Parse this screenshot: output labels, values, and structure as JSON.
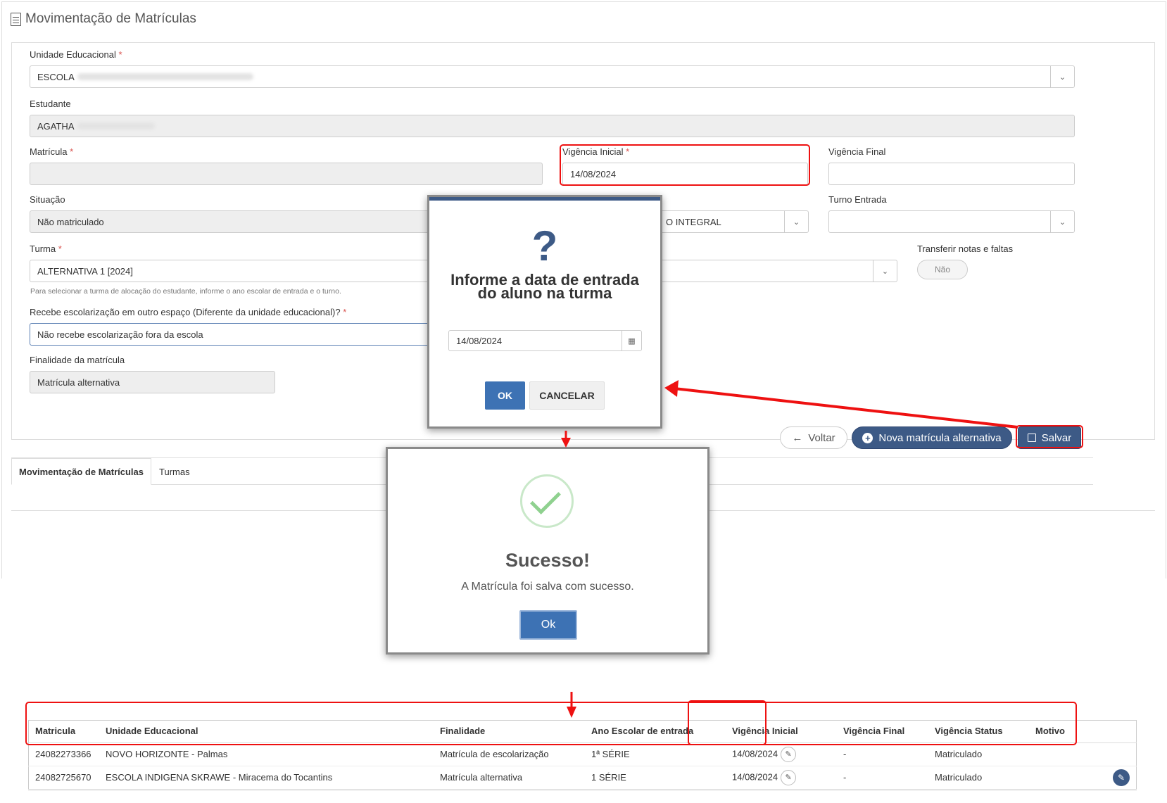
{
  "page": {
    "title": "Movimentação de Matrículas"
  },
  "form": {
    "unidade_label": "Unidade Educacional",
    "unidade_value": "ESCOLA",
    "estudante_label": "Estudante",
    "estudante_value": "AGATHA",
    "matricula_label": "Matrícula",
    "matricula_value": "",
    "vig_inicial_label": "Vigência Inicial",
    "vig_inicial_value": "14/08/2024",
    "vig_final_label": "Vigência Final",
    "vig_final_value": "",
    "situacao_label": "Situação",
    "situacao_value": "Não matriculado",
    "modalidade_value": "O INTEGRAL",
    "turno_label": "Turno Entrada",
    "turno_value": "",
    "turma_label": "Turma",
    "turma_value": "ALTERNATIVA 1 [2024]",
    "turma_hint": "Para selecionar a turma de alocação do estudante, informe o ano escolar de entrada e o turno.",
    "transferir_label": "Transferir notas e faltas",
    "transferir_value": "Não",
    "recebe_label": "Recebe escolarização em outro espaço (Diferente da unidade educacional)?",
    "recebe_value": "Não recebe escolarização fora da escola",
    "finalidade_label": "Finalidade da matrícula",
    "finalidade_value": "Matrícula alternativa",
    "required_mark": "*"
  },
  "actions": {
    "voltar": "Voltar",
    "nova": "Nova matrícula alternativa",
    "salvar": "Salvar"
  },
  "tabs": [
    "Movimentação de Matrículas",
    "Turmas"
  ],
  "dialog_date": {
    "icon": "?",
    "title": "Informe a data de entrada do aluno na turma",
    "date_value": "14/08/2024",
    "ok": "OK",
    "cancel": "CANCELAR"
  },
  "dialog_success": {
    "title": "Sucesso!",
    "message": "A Matrícula foi salva com sucesso.",
    "ok": "Ok"
  },
  "table": {
    "headers": [
      "Matricula",
      "Unidade Educacional",
      "Finalidade",
      "Ano Escolar de entrada",
      "Vigência Inicial",
      "Vigência Final",
      "Vigência Status",
      "Motivo"
    ],
    "rows": [
      [
        "24082273366",
        "NOVO HORIZONTE - Palmas",
        "Matrícula de escolarização",
        "1ª SÉRIE",
        "14/08/2024",
        "-",
        "Matriculado",
        ""
      ],
      [
        "24082725670",
        "ESCOLA INDIGENA SKRAWE - Miracema do Tocantins",
        "Matrícula alternativa",
        "1 SÉRIE",
        "14/08/2024",
        "-",
        "Matriculado",
        ""
      ]
    ]
  },
  "colors": {
    "primary": "#3d5a86",
    "highlight": "#ee1111",
    "success": "#8fd18f"
  }
}
